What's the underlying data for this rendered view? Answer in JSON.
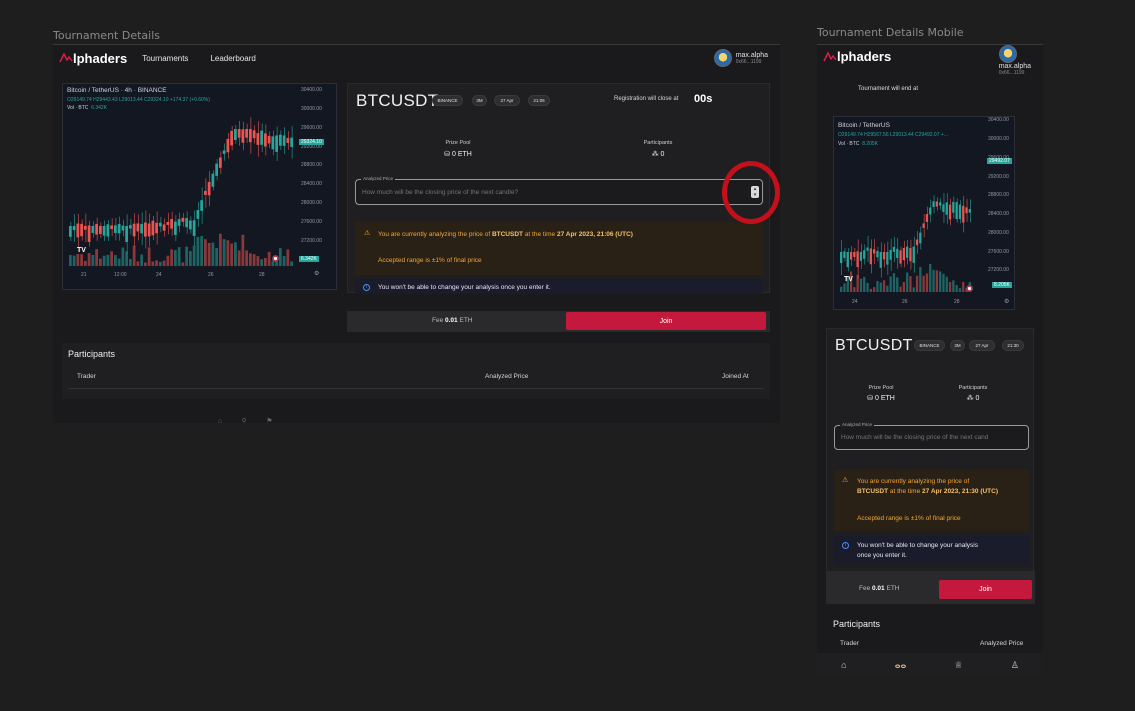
{
  "frames": {
    "desktop_label": "Tournament Details",
    "mobile_label": "Tournament Details Mobile"
  },
  "nav": {
    "logo_text": "lphaders",
    "links": [
      "Tournaments",
      "Leaderboard"
    ],
    "user_name": "max.alpha",
    "user_address": "0x66...1199"
  },
  "chart": {
    "symbol_line": "Bitcoin / TetherUS · 4h · BINANCE",
    "ohlc_line": "O29149.74 H29443.43 L29013.44 C29324.10 +174.37 (+0.60%)",
    "vol_label": "Vol · BTC",
    "vol_value": "6.342K",
    "price_tag": "29324.10",
    "vol_tag": "6.342K",
    "y_ticks": [
      "30400.00",
      "30000.00",
      "29600.00",
      "29200.00",
      "28800.00",
      "28400.00",
      "28000.00",
      "27600.00",
      "27200.00"
    ],
    "x_ticks": [
      "21",
      "12:00",
      "24",
      "26",
      "28"
    ],
    "tv_logo": "TV"
  },
  "mobile_chart": {
    "symbol_line": "Bitcoin / TetherUS",
    "ohlc_line": "O29149.74 H29567.56 L29013.44 C29492.07 +...",
    "vol_label": "Vol · BTC",
    "vol_value": "8.205K",
    "price_tag": "29492.07",
    "vol_tag": "8.205K",
    "y_ticks": [
      "30400.00",
      "30000.00",
      "29600.00",
      "29200.00",
      "28800.00",
      "28400.00",
      "28000.00",
      "27600.00",
      "27200.00"
    ],
    "x_ticks": [
      "24",
      "26",
      "28"
    ],
    "tv_logo": "TV"
  },
  "tournament": {
    "pair": "BTCUSDT",
    "exchange": "BINANCE",
    "interval": "3M",
    "date": "27 Apr",
    "time": "21:06",
    "registration_label": "Registration will close at",
    "registration_time": "00s",
    "prize_pool_label": "Prize Pool",
    "prize_pool_value": "⛁ 0 ETH",
    "participants_label": "Participants",
    "participants_value": "⁂ 0",
    "input_legend": "Analyzed Price",
    "input_placeholder": "How much will be the closing price of the next candle?",
    "warning_prefix": "You are currently analyzing the price of ",
    "warning_pair": "BTCUSDT",
    "warning_mid": " at the time ",
    "warning_time": "27 Apr 2023, 21:06 (UTC)",
    "range_text": "Accepted range is ±1% of final price",
    "info_text": "You won't be able to change your analysis once you enter it.",
    "fee_label": "Fee ",
    "fee_value": "0.01",
    "fee_unit": " ETH",
    "join_label": "Join"
  },
  "mobile_tournament": {
    "ends_label": "Tournament will end at",
    "pair": "BTCUSDT",
    "exchange": "BINANCE",
    "interval": "3M",
    "date": "27 Apr",
    "time": "21:30",
    "warning_line1": "You are currently analyzing the price of",
    "warning_pair": "BTCUSDT",
    "warning_mid": " at the time ",
    "warning_time": "27 Apr 2023, 21:30 (UTC)",
    "info_line1": "You won't be able to change your analysis",
    "info_line2": "once you enter it.",
    "input_placeholder": "How much will be the closing price of the next cand"
  },
  "participants": {
    "title": "Participants",
    "col_trader": "Trader",
    "col_price": "Analyzed Price",
    "col_joined": "Joined At"
  },
  "colors": {
    "accent": "#c4193d",
    "up": "#26a69a",
    "down": "#ef5350",
    "warning": "#f4a533",
    "info": "#4a90f0"
  },
  "icons": [
    "logo-icon",
    "avatar",
    "warning-icon",
    "info-icon",
    "stepper-icon",
    "eth-icon",
    "people-icon",
    "home-icon",
    "tournaments-icon",
    "trophy-icon",
    "profile-icon"
  ]
}
